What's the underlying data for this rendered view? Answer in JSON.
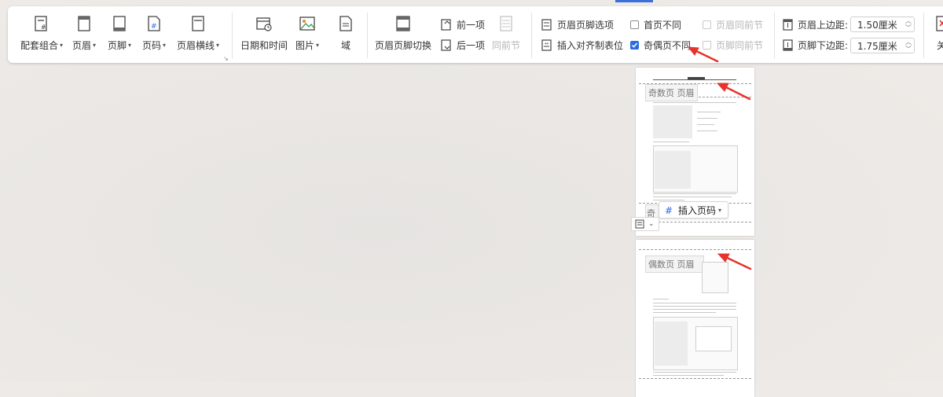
{
  "ribbon": {
    "groups1": [
      {
        "label": "配套组合",
        "icon": "combo-icon",
        "has_dropdown": true
      },
      {
        "label": "页眉",
        "icon": "header-icon",
        "has_dropdown": true
      },
      {
        "label": "页脚",
        "icon": "footer-icon",
        "has_dropdown": true
      },
      {
        "label": "页码",
        "icon": "page-number-icon",
        "has_dropdown": true
      },
      {
        "label": "页眉横线",
        "icon": "header-line-icon",
        "has_dropdown": true
      }
    ],
    "groups2": [
      {
        "label": "日期和时间",
        "icon": "calendar-icon",
        "has_dropdown": false
      },
      {
        "label": "图片",
        "icon": "picture-icon",
        "has_dropdown": true
      },
      {
        "label": "域",
        "icon": "field-icon",
        "has_dropdown": false
      }
    ],
    "switch": {
      "label": "页眉页脚切换",
      "icon": "header-footer-switch-icon"
    },
    "nav": {
      "prev": "前一项",
      "next": "后一项",
      "same": "同前节"
    },
    "options": {
      "hf_options": "页眉页脚选项",
      "insert_tab": "插入对齐制表位",
      "first_diff": "首页不同",
      "first_diff_checked": false,
      "odd_even_diff": "奇偶页不同",
      "odd_even_checked": true,
      "header_same": "页眉同前节",
      "footer_same": "页脚同前节"
    },
    "margins": {
      "top_label": "页眉上边距:",
      "top_value": "1.50厘米",
      "bottom_label": "页脚下边距:",
      "bottom_value": "1.75厘米"
    },
    "close_label": "关"
  },
  "pages": {
    "odd_header_label": "奇数页 页眉",
    "even_header_label": "偶数页 页眉",
    "odd_footer_label": "奇",
    "insert_page_number": "插入页码"
  },
  "colors": {
    "accent": "#2b6de0",
    "arrow": "#e8322d"
  }
}
